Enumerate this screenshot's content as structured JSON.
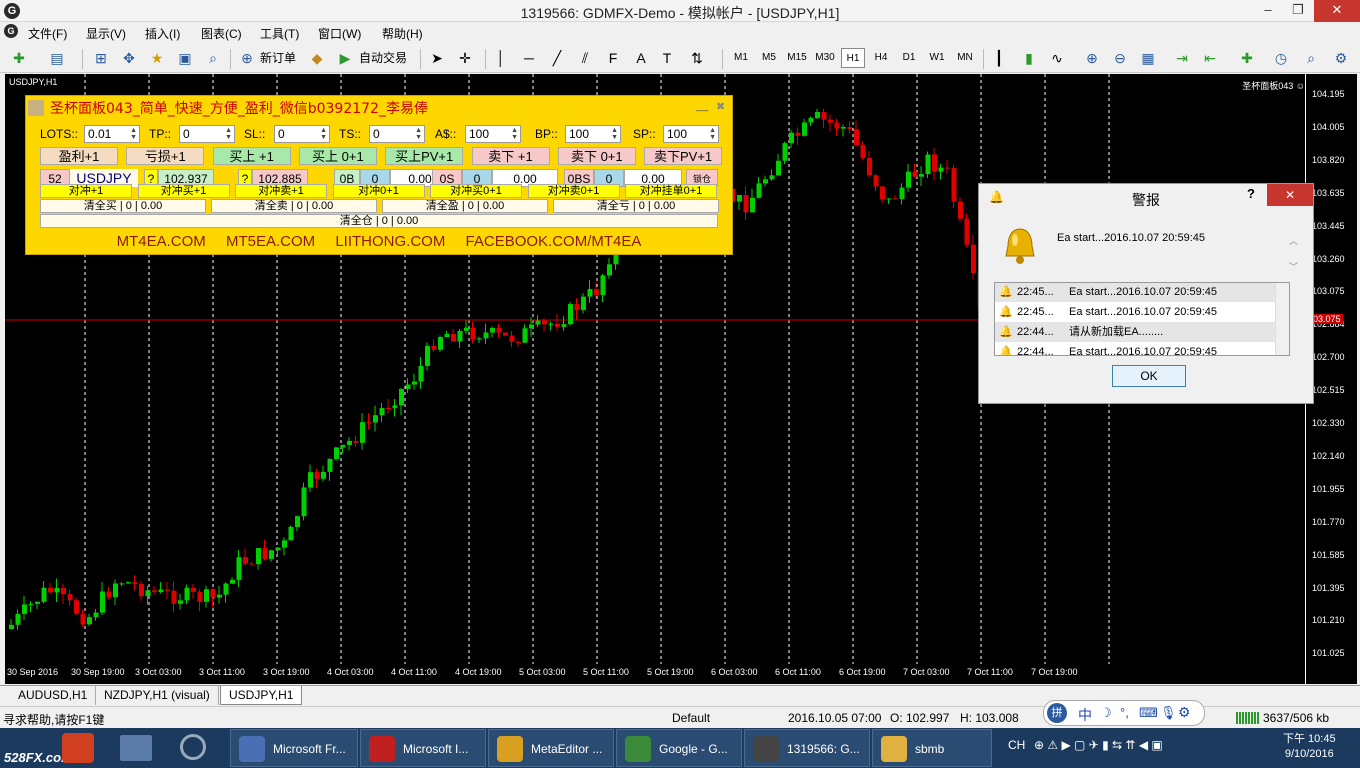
{
  "window": {
    "title": "1319566: GDMFX-Demo - 模拟帐户 - [USDJPY,H1]",
    "app_icon": "G",
    "minimize": "–",
    "restore": "❐",
    "close": "✕"
  },
  "menu": [
    "文件(F)",
    "显示(V)",
    "插入(I)",
    "图表(C)",
    "工具(T)",
    "窗口(W)",
    "帮助(H)"
  ],
  "toolbar": {
    "new_order": "新订单",
    "auto_trade": "自动交易",
    "timeframes": [
      "M1",
      "M5",
      "M15",
      "M30",
      "H1",
      "H4",
      "D1",
      "W1",
      "MN"
    ],
    "active_timeframe": "H1"
  },
  "chart": {
    "symbol_label": "USDJPY,H1",
    "ea_label": "圣杯面板043 ☺",
    "price_labels": [
      "104.195",
      "104.005",
      "103.820",
      "103.635",
      "103.445",
      "103.260",
      "103.075",
      "102.884",
      "102.700",
      "102.515",
      "102.330",
      "102.140",
      "101.955",
      "101.770",
      "101.585",
      "101.395",
      "101.210",
      "101.025"
    ],
    "current_price": "103.075",
    "time_labels": [
      "30 Sep 2016",
      "30 Sep 19:00",
      "3 Oct 03:00",
      "3 Oct 11:00",
      "3 Oct 19:00",
      "4 Oct 03:00",
      "4 Oct 11:00",
      "4 Oct 19:00",
      "5 Oct 03:00",
      "5 Oct 11:00",
      "5 Oct 19:00",
      "6 Oct 03:00",
      "6 Oct 11:00",
      "6 Oct 19:00",
      "7 Oct 03:00",
      "7 Oct 11:00",
      "7 Oct 19:00"
    ],
    "colors": {
      "bull": "#00d000",
      "bear": "#e00000",
      "grid": "#ffffff",
      "background": "#000000"
    }
  },
  "panel": {
    "title": "圣杯面板043_简单_快速_方便_盈利_微信b0392172_李易俸",
    "min_btn": "__",
    "close_btn": "✖",
    "fields": [
      {
        "label": "LOTS::",
        "value": "0.01"
      },
      {
        "label": "TP::",
        "value": "0"
      },
      {
        "label": "SL::",
        "value": "0"
      },
      {
        "label": "TS::",
        "value": "0"
      },
      {
        "label": "A$::",
        "value": "100"
      },
      {
        "label": "BP::",
        "value": "100"
      },
      {
        "label": "SP::",
        "value": "100"
      }
    ],
    "row2": [
      "盈利+1",
      "亏损+1",
      "买上 +1",
      "买上 0+1",
      "买上PV+1",
      "卖下 +1",
      "卖下 0+1",
      "卖下PV+1"
    ],
    "row3": {
      "count": "52",
      "symbol": "USDJPY",
      "q1": "?",
      "ask": "102.937",
      "q2": "?",
      "bid": "102.885",
      "ob": "0B",
      "ob_count": "0",
      "ob_val": "0.00",
      "os": "0S",
      "os_count": "0",
      "os_val": "0.00",
      "obs": "0BS",
      "obs_count": "0",
      "obs_val": "0.00",
      "lock": "锁仓"
    },
    "row4": [
      "对冲+1",
      "对冲买+1",
      "对冲卖+1",
      "对冲0+1",
      "对冲买0+1",
      "对冲卖0+1",
      "对冲挂单0+1"
    ],
    "row5": [
      "清全买 | 0 | 0.00",
      "清全卖 | 0 | 0.00",
      "清全盈 | 0 | 0.00",
      "清全亏 | 0 | 0.00"
    ],
    "row6": "清全仓 | 0 | 0.00",
    "footer": [
      "MT4EA.COM",
      "MT5EA.COM",
      "LIITHONG.COM",
      "FACEBOOK.COM/MT4EA"
    ]
  },
  "alert": {
    "title": "警报",
    "help": "?",
    "close": "✕",
    "message": "Ea start...2016.10.07 20:59:45",
    "rows": [
      {
        "time": "22:45...",
        "text": "Ea start...2016.10.07 20:59:45"
      },
      {
        "time": "22:45...",
        "text": "Ea start...2016.10.07 20:59:45"
      },
      {
        "time": "22:44...",
        "text": "请从新加载EA........"
      },
      {
        "time": "22:44...",
        "text": "Ea start...2016.10.07 20:59:45"
      }
    ],
    "ok": "OK"
  },
  "tabs": [
    "AUDUSD,H1",
    "NZDJPY,H1 (visual)",
    "USDJPY,H1"
  ],
  "active_tab": "USDJPY,H1",
  "status": {
    "help": "寻求帮助,请按F1键",
    "profile": "Default",
    "datetime": "2016.10.05 07:00",
    "open": "O: 102.997",
    "high": "H: 103.008",
    "traffic": "3637/506 kb"
  },
  "taskbar": {
    "items": [
      {
        "label": "Microsoft Fr...",
        "icon": "ms-icon",
        "color": "#4a6fb5"
      },
      {
        "label": "Microsoft I...",
        "icon": "paint-icon",
        "color": "#c02020"
      },
      {
        "label": "MetaEditor ...",
        "icon": "metaeditor-icon",
        "color": "#d8a020"
      },
      {
        "label": "Google - G...",
        "icon": "chrome-icon",
        "color": "#3a8a3a"
      },
      {
        "label": "1319566: G...",
        "icon": "mt4-icon",
        "color": "#444444"
      },
      {
        "label": "sbmb",
        "icon": "folder-icon",
        "color": "#e0b040"
      }
    ],
    "watermark": "528FX.com",
    "lang": "CH",
    "time": "下午 10:45",
    "date": "9/10/2016",
    "ime": "中"
  }
}
